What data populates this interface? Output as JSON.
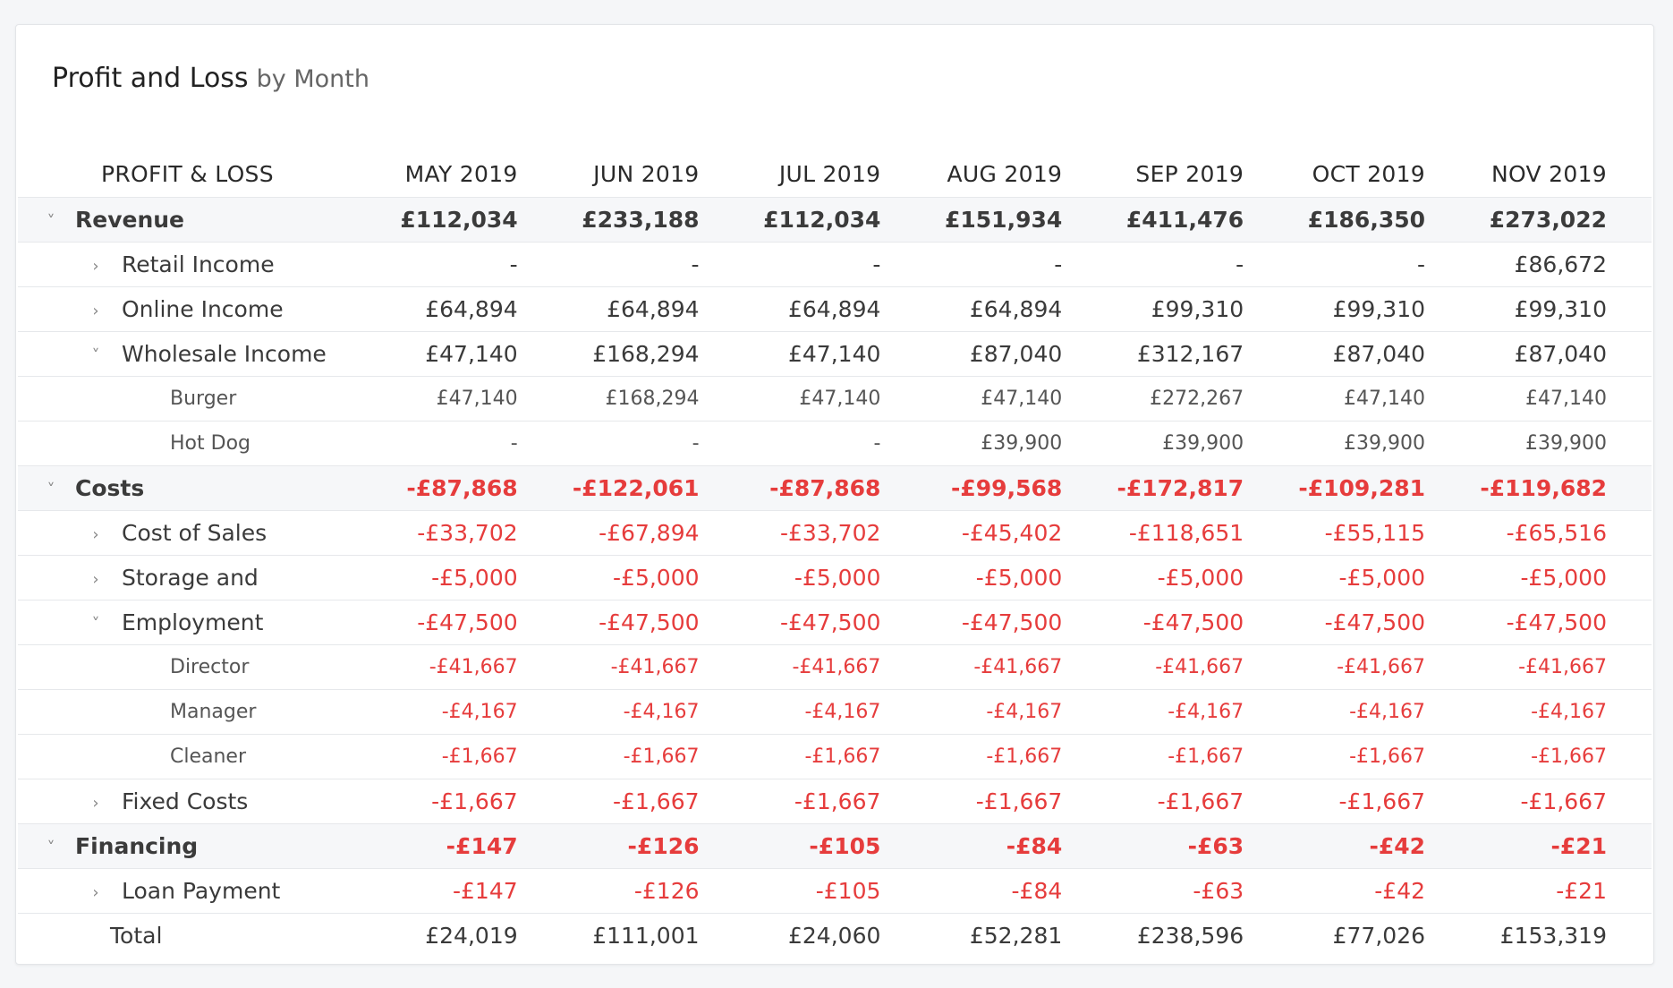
{
  "title": {
    "main": "Profit and Loss",
    "sub": "by Month"
  },
  "columns": [
    "PROFIT & LOSS",
    "MAY 2019",
    "JUN 2019",
    "JUL 2019",
    "AUG 2019",
    "SEP 2019",
    "OCT 2019",
    "NOV 2019"
  ],
  "colors": {
    "negative": "#e63c3c",
    "group_bg": "#f6f7f9"
  },
  "rows": [
    {
      "label": "Revenue",
      "type": "group",
      "level": 0,
      "caret": "chevron-down-icon",
      "negative": false,
      "values": [
        "£112,034",
        "£233,188",
        "£112,034",
        "£151,934",
        "£411,476",
        "£186,350",
        "£273,022"
      ]
    },
    {
      "label": "Retail Income",
      "type": "sub",
      "level": 1,
      "caret": "chevron-right-icon",
      "negative": false,
      "values": [
        "-",
        "-",
        "-",
        "-",
        "-",
        "-",
        "£86,672"
      ]
    },
    {
      "label": "Online Income",
      "type": "sub",
      "level": 1,
      "caret": "chevron-right-icon",
      "negative": false,
      "values": [
        "£64,894",
        "£64,894",
        "£64,894",
        "£64,894",
        "£99,310",
        "£99,310",
        "£99,310"
      ]
    },
    {
      "label": "Wholesale Income",
      "type": "sub",
      "level": 1,
      "caret": "chevron-down-icon",
      "negative": false,
      "values": [
        "£47,140",
        "£168,294",
        "£47,140",
        "£87,040",
        "£312,167",
        "£87,040",
        "£87,040"
      ]
    },
    {
      "label": "Burger",
      "type": "leaf",
      "level": 2,
      "caret": null,
      "negative": false,
      "values": [
        "£47,140",
        "£168,294",
        "£47,140",
        "£47,140",
        "£272,267",
        "£47,140",
        "£47,140"
      ]
    },
    {
      "label": "Hot Dog",
      "type": "leaf",
      "level": 2,
      "caret": null,
      "negative": false,
      "values": [
        "-",
        "-",
        "-",
        "£39,900",
        "£39,900",
        "£39,900",
        "£39,900"
      ]
    },
    {
      "label": "Costs",
      "type": "group",
      "level": 0,
      "caret": "chevron-down-icon",
      "negative": true,
      "values": [
        "-£87,868",
        "-£122,061",
        "-£87,868",
        "-£99,568",
        "-£172,817",
        "-£109,281",
        "-£119,682"
      ]
    },
    {
      "label": "Cost of Sales",
      "type": "sub",
      "level": 1,
      "caret": "chevron-right-icon",
      "negative": true,
      "values": [
        "-£33,702",
        "-£67,894",
        "-£33,702",
        "-£45,402",
        "-£118,651",
        "-£55,115",
        "-£65,516"
      ]
    },
    {
      "label": "Storage and",
      "type": "sub",
      "level": 1,
      "caret": "chevron-right-icon",
      "negative": true,
      "values": [
        "-£5,000",
        "-£5,000",
        "-£5,000",
        "-£5,000",
        "-£5,000",
        "-£5,000",
        "-£5,000"
      ]
    },
    {
      "label": "Employment",
      "type": "sub",
      "level": 1,
      "caret": "chevron-down-icon",
      "negative": true,
      "values": [
        "-£47,500",
        "-£47,500",
        "-£47,500",
        "-£47,500",
        "-£47,500",
        "-£47,500",
        "-£47,500"
      ]
    },
    {
      "label": "Director",
      "type": "leaf",
      "level": 2,
      "caret": null,
      "negative": true,
      "values": [
        "-£41,667",
        "-£41,667",
        "-£41,667",
        "-£41,667",
        "-£41,667",
        "-£41,667",
        "-£41,667"
      ]
    },
    {
      "label": "Manager",
      "type": "leaf",
      "level": 2,
      "caret": null,
      "negative": true,
      "values": [
        "-£4,167",
        "-£4,167",
        "-£4,167",
        "-£4,167",
        "-£4,167",
        "-£4,167",
        "-£4,167"
      ]
    },
    {
      "label": "Cleaner",
      "type": "leaf",
      "level": 2,
      "caret": null,
      "negative": true,
      "values": [
        "-£1,667",
        "-£1,667",
        "-£1,667",
        "-£1,667",
        "-£1,667",
        "-£1,667",
        "-£1,667"
      ]
    },
    {
      "label": "Fixed Costs",
      "type": "sub",
      "level": 1,
      "caret": "chevron-right-icon",
      "negative": true,
      "values": [
        "-£1,667",
        "-£1,667",
        "-£1,667",
        "-£1,667",
        "-£1,667",
        "-£1,667",
        "-£1,667"
      ]
    },
    {
      "label": "Financing",
      "type": "group",
      "level": 0,
      "caret": "chevron-down-icon",
      "negative": true,
      "values": [
        "-£147",
        "-£126",
        "-£105",
        "-£84",
        "-£63",
        "-£42",
        "-£21"
      ]
    },
    {
      "label": "Loan Payment",
      "type": "sub",
      "level": 1,
      "caret": "chevron-right-icon",
      "negative": true,
      "values": [
        "-£147",
        "-£126",
        "-£105",
        "-£84",
        "-£63",
        "-£42",
        "-£21"
      ]
    },
    {
      "label": "Total",
      "type": "total",
      "level": 0,
      "caret": null,
      "negative": false,
      "values": [
        "£24,019",
        "£111,001",
        "£24,060",
        "£52,281",
        "£238,596",
        "£77,026",
        "£153,319"
      ]
    }
  ]
}
